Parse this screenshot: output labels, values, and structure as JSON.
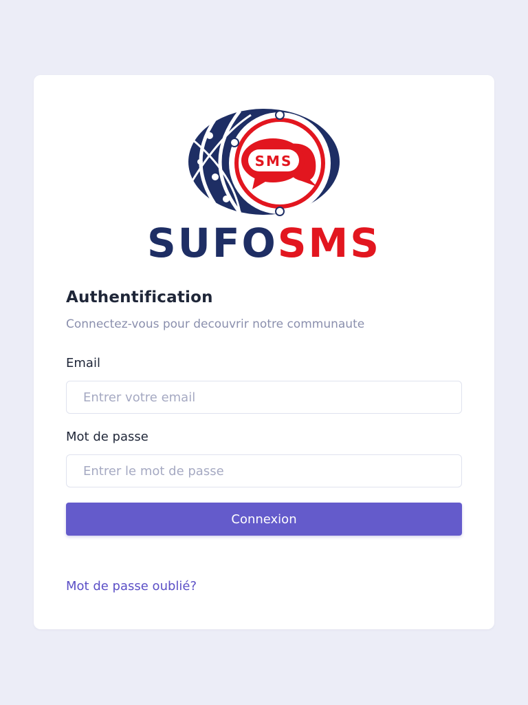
{
  "brand": {
    "badge_text": "SMS",
    "name_part1": "SUFO",
    "name_part2": "SMS",
    "colors": {
      "navy": "#1e2e64",
      "red": "#e2161f"
    }
  },
  "auth": {
    "title": "Authentification",
    "subtitle": "Connectez-vous pour decouvrir notre communaute",
    "email": {
      "label": "Email",
      "placeholder": "Entrer votre email",
      "value": ""
    },
    "password": {
      "label": "Mot de passe",
      "placeholder": "Entrer le mot de passe",
      "value": ""
    },
    "submit_label": "Connexion",
    "forgot_label": "Mot de passe oublié?"
  },
  "theme": {
    "accent": "#645bcb",
    "background": "#ecedf7",
    "link": "#5b4fc6"
  }
}
